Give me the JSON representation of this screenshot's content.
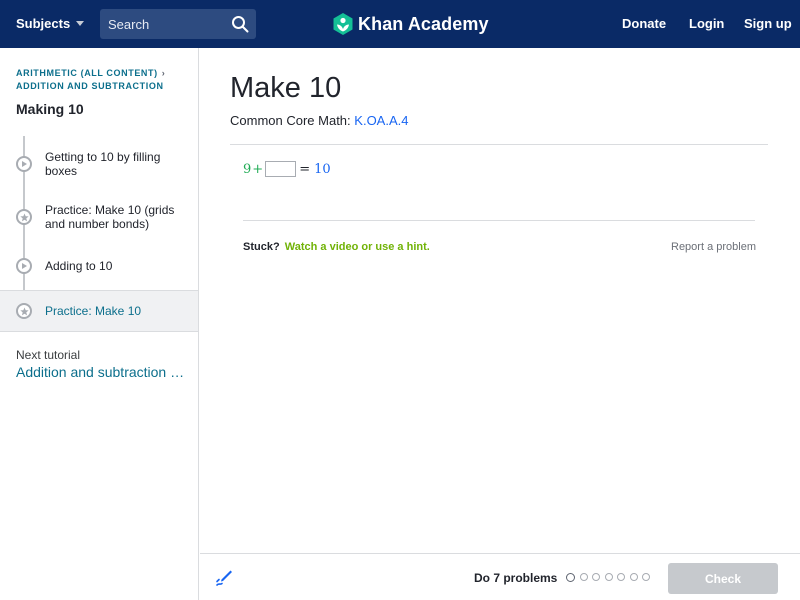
{
  "header": {
    "subjects_label": "Subjects",
    "search_placeholder": "Search",
    "logo_text": "Khan Academy",
    "donate": "Donate",
    "login": "Login",
    "signup": "Sign up",
    "bg_color": "#0a2a66"
  },
  "sidebar": {
    "breadcrumb_1": "ARITHMETIC (ALL CONTENT)",
    "breadcrumb_2": "ADDITION AND SUBTRACTION",
    "tutorial_title": "Making 10",
    "items": [
      {
        "label": "Getting to 10 by filling boxes",
        "icon": "play-icon"
      },
      {
        "label": "Practice: Make 10 (grids and number bonds)",
        "icon": "star-icon"
      },
      {
        "label": "Adding to 10",
        "icon": "play-icon"
      },
      {
        "label": "Practice: Make 10",
        "icon": "star-icon",
        "active": true
      }
    ],
    "next_label": "Next tutorial",
    "next_link": "Addition and subtraction w..."
  },
  "main": {
    "title": "Make 10",
    "standard_prefix": "Common Core Math:",
    "standard_link": "K.OA.A.4",
    "problem": {
      "lhs": "9",
      "op": "+",
      "eq": "=",
      "rhs": "10",
      "answer": ""
    },
    "stuck_label": "Stuck?",
    "hint_link": "Watch a video or use a hint.",
    "report": "Report a problem"
  },
  "footer": {
    "do_problems": "Do 7 problems",
    "progress_total": 7,
    "progress_done": 0,
    "check_label": "Check"
  }
}
